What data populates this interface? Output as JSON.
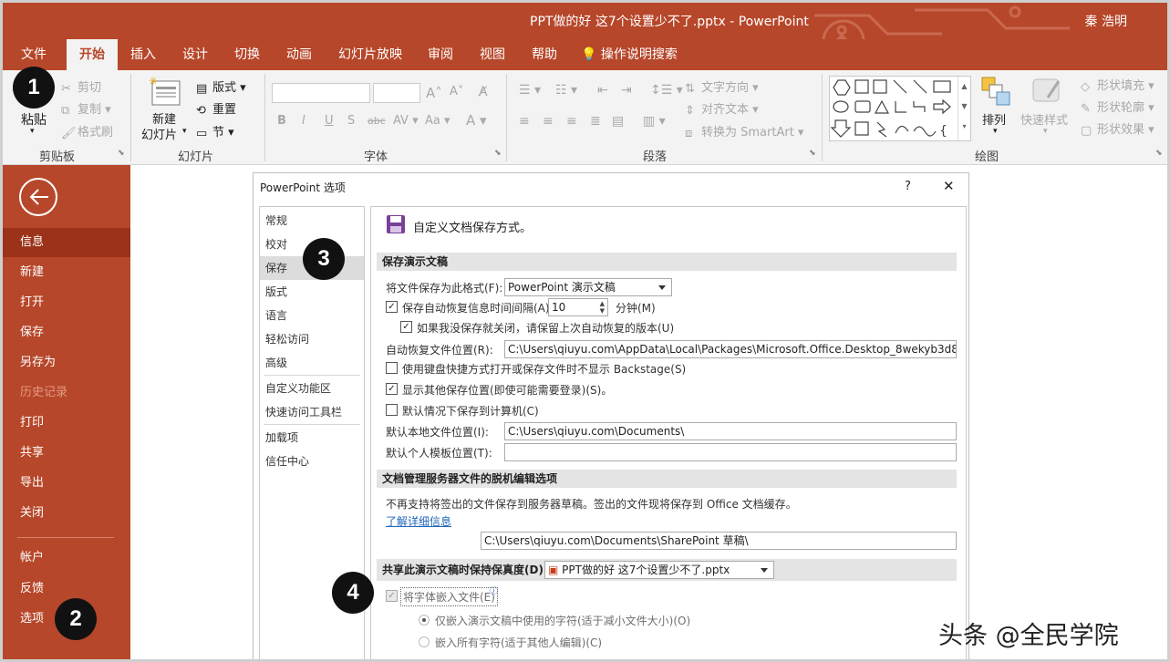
{
  "app": {
    "window_title": "PPT做的好 这7个设置少不了.pptx - PowerPoint",
    "user_name": "秦 浩明",
    "accent_color": "#b7472a"
  },
  "menu_tabs": [
    "文件",
    "开始",
    "插入",
    "设计",
    "切换",
    "动画",
    "幻灯片放映",
    "审阅",
    "视图",
    "帮助",
    "操作说明搜索"
  ],
  "ribbon": {
    "clipboard": {
      "paste": "粘贴",
      "cut": "剪切",
      "copy": "复制",
      "format_painter": "格式刷",
      "group": "剪贴板"
    },
    "slides": {
      "new_slide_line1": "新建",
      "new_slide_line2": "幻灯片",
      "layout": "版式",
      "reset": "重置",
      "section": "节",
      "group": "幻灯片"
    },
    "font": {
      "group": "字体"
    },
    "paragraph": {
      "text_direction": "文字方向",
      "align_text": "对齐文本",
      "smartart": "转换为 SmartArt",
      "group": "段落"
    },
    "drawing": {
      "arrange": "排列",
      "quick_styles": "快速样式",
      "shape_fill": "形状填充",
      "shape_outline": "形状轮廓",
      "shape_effects": "形状效果",
      "group": "绘图"
    }
  },
  "backstage": {
    "items": [
      "信息",
      "新建",
      "打开",
      "保存",
      "另存为",
      "历史记录",
      "打印",
      "共享",
      "导出",
      "关闭",
      "帐户",
      "反馈",
      "选项"
    ]
  },
  "dialog": {
    "title": "PowerPoint 选项",
    "help": "?",
    "close": "✕",
    "nav_items": [
      "常规",
      "校对",
      "保存",
      "版式",
      "语言",
      "轻松访问",
      "高级",
      "自定义功能区",
      "快速访问工具栏",
      "加载项",
      "信任中心"
    ],
    "header": "自定义文档保存方式。",
    "section_save": "保存演示文稿",
    "save_format_label": "将文件保存为此格式(F):",
    "save_format_value": "PowerPoint 演示文稿",
    "autorecover_label": "保存自动恢复信息时间间隔(A)",
    "autorecover_minutes": "10",
    "minutes_label": "分钟(M)",
    "keep_last_label": "如果我没保存就关闭，请保留上次自动恢复的版本(U)",
    "autorecover_path_label": "自动恢复文件位置(R):",
    "autorecover_path": "C:\\Users\\qiuyu.com\\AppData\\Local\\Packages\\Microsoft.Office.Desktop_8wekyb3d8bbwe\\Lo",
    "no_backstage_label": "使用键盘快捷方式打开或保存文件时不显示 Backstage(S)",
    "show_other_label": "显示其他保存位置(即使可能需要登录)(S)。",
    "save_computer_label": "默认情况下保存到计算机(C)",
    "local_path_label": "默认本地文件位置(I):",
    "local_path": "C:\\Users\\qiuyu.com\\Documents\\",
    "template_path_label": "默认个人模板位置(T):",
    "template_path": "",
    "section_offline": "文档管理服务器文件的脱机编辑选项",
    "offline_note": "不再支持将签出的文件保存到服务器草稿。签出的文件现将保存到 Office 文档缓存。",
    "learn_more": "了解详细信息",
    "drafts_label": "服务器草稿位置(V):",
    "drafts_path": "C:\\Users\\qiuyu.com\\Documents\\SharePoint 草稿\\",
    "section_fidelity": "共享此演示文稿时保持保真度(D):",
    "fidelity_file": "PPT做的好 这7个设置少不了.pptx",
    "embed_fonts_label": "将字体嵌入文件(E)",
    "embed_used_label": "仅嵌入演示文稿中使用的字符(适于减小文件大小)(O)",
    "embed_all_label": "嵌入所有字符(适于其他人编辑)(C)"
  },
  "badges": [
    "1",
    "2",
    "3",
    "4"
  ],
  "watermark": "头条 @全民学院"
}
